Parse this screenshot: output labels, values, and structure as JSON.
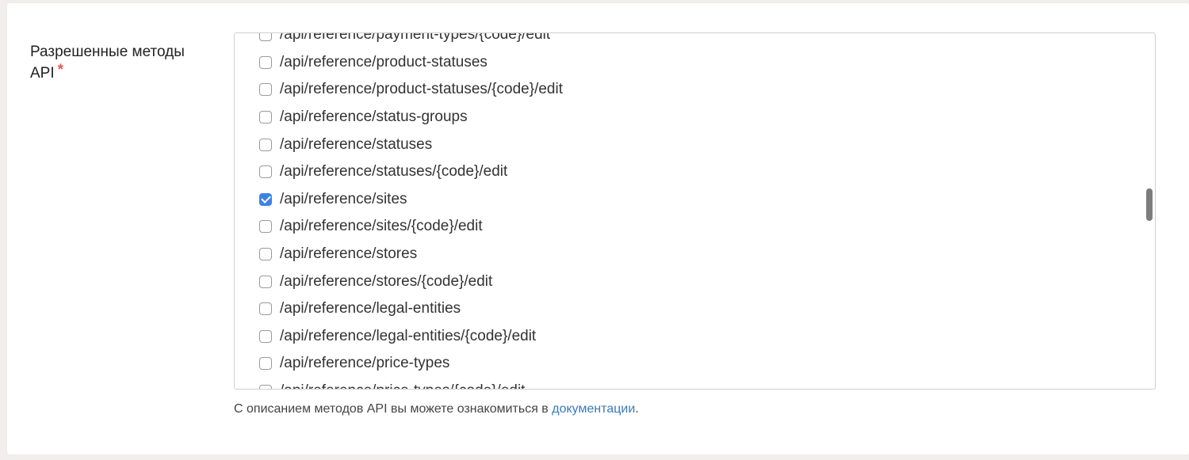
{
  "field": {
    "label": "Разрешенные методы API",
    "required_marker": "*"
  },
  "methods": {
    "items": [
      {
        "label": "/api/reference/payment-types/{code}/edit",
        "checked": false
      },
      {
        "label": "/api/reference/product-statuses",
        "checked": false
      },
      {
        "label": "/api/reference/product-statuses/{code}/edit",
        "checked": false
      },
      {
        "label": "/api/reference/status-groups",
        "checked": false
      },
      {
        "label": "/api/reference/statuses",
        "checked": false
      },
      {
        "label": "/api/reference/statuses/{code}/edit",
        "checked": false
      },
      {
        "label": "/api/reference/sites",
        "checked": true
      },
      {
        "label": "/api/reference/sites/{code}/edit",
        "checked": false
      },
      {
        "label": "/api/reference/stores",
        "checked": false
      },
      {
        "label": "/api/reference/stores/{code}/edit",
        "checked": false
      },
      {
        "label": "/api/reference/legal-entities",
        "checked": false
      },
      {
        "label": "/api/reference/legal-entities/{code}/edit",
        "checked": false
      },
      {
        "label": "/api/reference/price-types",
        "checked": false
      },
      {
        "label": "/api/reference/price-types/{code}/edit",
        "checked": false
      }
    ]
  },
  "help": {
    "text_before": "С описанием методов API вы можете ознакомиться в ",
    "link_text": "документации",
    "text_after": "."
  },
  "colors": {
    "accent": "#3b82e6",
    "link": "#3a7ab8",
    "required": "#e05a5a"
  }
}
